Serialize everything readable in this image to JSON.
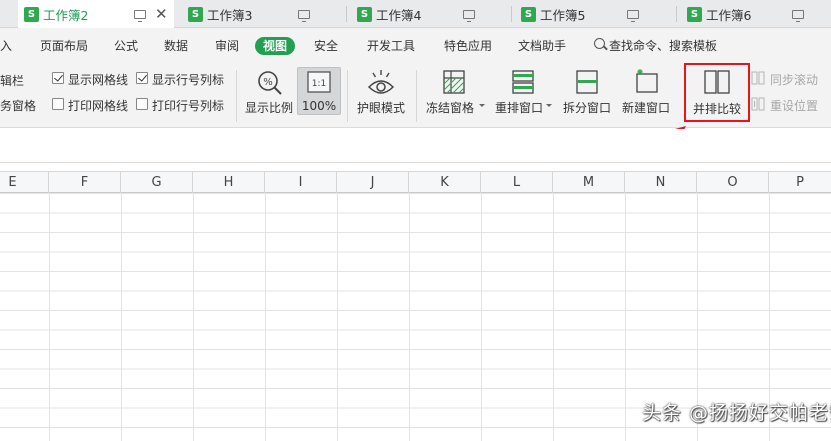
{
  "tabs": [
    {
      "label": "工作簿2",
      "active": true
    },
    {
      "label": "工作簿3",
      "active": false
    },
    {
      "label": "工作簿4",
      "active": false
    },
    {
      "label": "工作簿5",
      "active": false
    },
    {
      "label": "工作簿6",
      "active": false
    }
  ],
  "tab_badge": "S",
  "menu": {
    "items": [
      "插入",
      "页面布局",
      "公式",
      "数据",
      "审阅",
      "视图",
      "安全",
      "开发工具",
      "特色应用",
      "文档助手"
    ],
    "partial_first": "入",
    "active": "视图",
    "search_label": "查找命令、搜索模板"
  },
  "ribbon": {
    "left_partial_top": "辑栏",
    "left_partial_bottom": "务窗格",
    "show_gridlines": {
      "label": "显示网格线",
      "checked": true
    },
    "show_headers": {
      "label": "显示行号列标",
      "checked": true
    },
    "print_gridlines": {
      "label": "打印网格线",
      "checked": false
    },
    "print_headers": {
      "label": "打印行号列标",
      "checked": false
    },
    "zoom_label": "显示比例",
    "zoom_100_label": "100%",
    "zoom_100_icon_text": "1:1",
    "eye_protect_label": "护眼模式",
    "freeze_label": "冻结窗格",
    "arrange_label": "重排窗口",
    "split_label": "拆分窗口",
    "new_window_label": "新建窗口",
    "side_by_side_label": "并排比较",
    "sync_scroll_label": "同步滚动",
    "reset_position_label": "重设位置"
  },
  "columns": [
    "E",
    "F",
    "G",
    "H",
    "I",
    "J",
    "K",
    "L",
    "M",
    "N",
    "O",
    "P"
  ],
  "watermark": "头条 @扬扬好交帕老师",
  "colors": {
    "accent_green": "#21a150",
    "highlight_red": "#e8141b"
  }
}
